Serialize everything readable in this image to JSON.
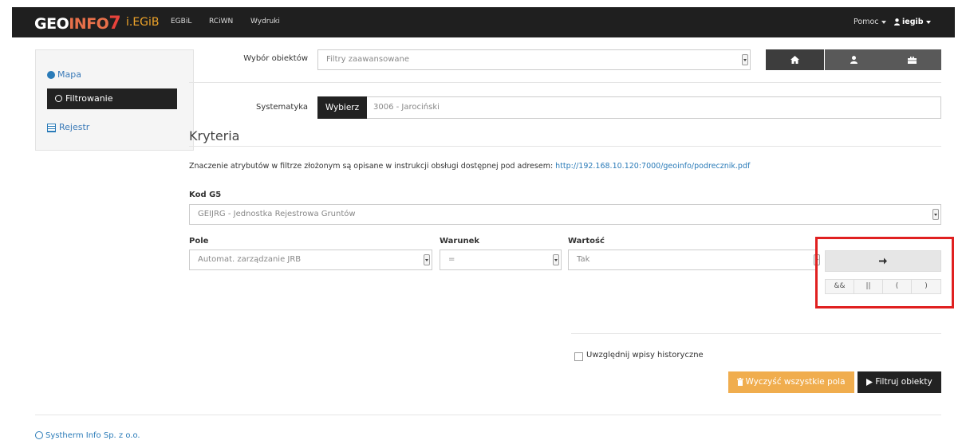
{
  "navbar": {
    "brand_geo": "GEO",
    "brand_info": "INFO",
    "brand_seven": "7",
    "brand_sub": "i.EGiB",
    "links": [
      "EGBiL",
      "RCiWN",
      "Wydruki"
    ],
    "help_label": "Pomoc",
    "user_label": "iegib"
  },
  "sidebar": {
    "items": [
      {
        "label": "Mapa",
        "icon": "globe-icon"
      },
      {
        "label": "Filtrowanie",
        "icon": "search-icon",
        "active": true
      },
      {
        "label": "Rejestr",
        "icon": "list-icon"
      }
    ]
  },
  "object_select": {
    "label": "Wybór obiektów",
    "value": "Filtry zaawansowane"
  },
  "icon_buttons": [
    "home-icon",
    "user-icon",
    "briefcase-icon"
  ],
  "systematyka": {
    "label": "Systematyka",
    "button": "Wybierz",
    "value": "3006 - Jarociński"
  },
  "criteria": {
    "heading": "Kryteria",
    "info_text": "Znaczenie atrybutów w filtrze złożonym są opisane w instrukcji obsługi dostępnej pod adresem: ",
    "info_link": "http://192.168.10.120:7000/geoinfo/podrecznik.pdf",
    "kod_label": "Kod G5",
    "kod_value": "GEIJRG - Jednostka Rejestrowa Gruntów",
    "pole_label": "Pole",
    "pole_value": "Automat. zarządzanie JRB",
    "warunek_label": "Warunek",
    "warunek_value": "=",
    "wartosc_label": "Wartość",
    "wartosc_value": "Tak",
    "operators": [
      "&&",
      "||",
      "(",
      ")"
    ]
  },
  "actions": {
    "history_label": "Uwzględnij wpisy historyczne",
    "clear_label": "Wyczyść wszystkie pola",
    "filter_label": "Filtruj obiekty"
  },
  "footer": {
    "text": "Systherm Info Sp. z o.o."
  }
}
